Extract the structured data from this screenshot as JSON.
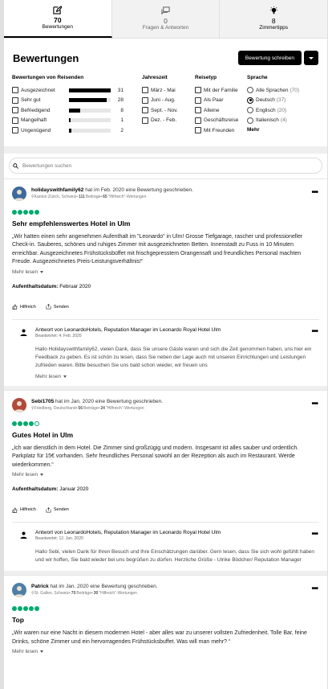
{
  "tabs": [
    {
      "count": "70",
      "label": "Bewertungen",
      "icon": "edit-icon"
    },
    {
      "count": "0",
      "label": "Fragen & Antworten",
      "icon": "chat-icon"
    },
    {
      "count": "8",
      "label": "Zimmertipps",
      "icon": "lightbulb-icon"
    }
  ],
  "header": {
    "title": "Bewertungen",
    "write_label": "Bewertung schreiben"
  },
  "filters": {
    "ratings_title": "Bewertungen von Reisenden",
    "ratings": [
      {
        "label": "Ausgezeichnet",
        "count": "31",
        "fraction": 1.0
      },
      {
        "label": "Sehr gut",
        "count": "28",
        "fraction": 0.9
      },
      {
        "label": "Befriedigend",
        "count": "8",
        "fraction": 0.26
      },
      {
        "label": "Mangelhaft",
        "count": "1",
        "fraction": 0.03
      },
      {
        "label": "Ungenügend",
        "count": "2",
        "fraction": 0.06
      }
    ],
    "season_title": "Jahreszeit",
    "seasons": [
      "März - Mai",
      "Juni - Aug.",
      "Sept. - Nov.",
      "Dez. - Feb."
    ],
    "type_title": "Reisetyp",
    "types": [
      "Mit der Familie",
      "Als Paar",
      "Alleine",
      "Geschäftsreise",
      "Mit Freunden"
    ],
    "lang_title": "Sprache",
    "langs": [
      {
        "label": "Alle Sprachen",
        "count": "(70)",
        "selected": false
      },
      {
        "label": "Deutsch",
        "count": "(37)",
        "selected": true
      },
      {
        "label": "Englisch",
        "count": "(20)",
        "selected": false
      },
      {
        "label": "Italienisch",
        "count": "(4)",
        "selected": false
      }
    ],
    "more_label": "Mehr"
  },
  "search": {
    "placeholder": "Bewertungen suchen"
  },
  "reviews": [
    {
      "user": "holidayswithfamily62",
      "action": "hat im Feb. 2020 eine Bewertung geschrieben.",
      "location": "Kanton Zürich, Schweiz",
      "contrib_count": "111",
      "contrib_label": "Beiträge",
      "helpful_count": "65",
      "helpful_label": "\"Hilfreich\"-Wertungen",
      "rating": 5,
      "title": "Sehr empfehlenswertes Hotel in Ulm",
      "text": "„Wir hatten einen sehr angenehmen Aufenthalt im \"Leonardo\" in Ulm! Grosse Tiefgarage, rascher und professioneller Check-in. Sauberes, schönes und ruhiges Zimmer mit ausgezeichneten Betten. Innenstadt zu Fuss in 10 Minuten erreichbar. Ausgezeichnetes Frühstücksbüffet mit frischgepresstem Orangensaft und freundliches Personal machten Freude. Ausgezeichnetes Preis-Leistungsverhältnis!“",
      "more": "Mehr lesen",
      "stay_label": "Aufenthaltsdatum:",
      "stay_value": "Februar 2020",
      "helpful_btn": "Hilfreich",
      "share_btn": "Senden",
      "response": {
        "name": "Antwort von LeonardoHotels, Reputation Manager im Leonardo Royal Hotel Ulm",
        "date": "Beantwortet: 4. Feb. 2020",
        "text": "Hallo Holidayswithfamily62, vielen Dank, dass Sie unsere Gäste waren und sich die Zeit genommen haben, uns hier ein Feedback zu geben. Es ist schön zu lesen, dass Sie neben der Lage auch mit unseren Einrichtungen und Leistungen zufrieden waren. Bitte besuchen Sie uns bald schon wieder, wir freuen uns",
        "more": "Mehr lesen"
      }
    },
    {
      "user": "Sebi1705",
      "action": "hat im Jan. 2020 eine Bewertung geschrieben.",
      "location": "Friedberg, Deutschland",
      "contrib_count": "56",
      "contrib_label": "Beiträge",
      "helpful_count": "24",
      "helpful_label": "\"Hilfreich\"-Wertungen",
      "rating": 4,
      "title": "Gutes Hotel in Ulm",
      "text": "„Ich war dienstlich in dem Hotel. Die Zimmer sind großzügig und modern. Insgesamt ist alles sauber und ordentlich. Parkplatz für 15€ vorhanden. Sehr freundliches Personal sowohl an der Rezeption als auch im Restaurant. Werde wiederkommen.“",
      "more": "Mehr lesen",
      "stay_label": "Aufenthaltsdatum:",
      "stay_value": "Januar 2020",
      "helpful_btn": "Hilfreich",
      "share_btn": "Senden",
      "response": {
        "name": "Antwort von LeonardoHotels, Reputation Manager im Leonardo Royal Hotel Ulm",
        "date": "Beantwortet: 12. Jan. 2020",
        "text": "Hallo Sebi, vielen Dank für Ihren Besuch und Ihre Einschätzungen darüber. Gern lesen, dass Sie sich wohl gefühlt haben und wir hoffen, Sie bald wieder bei uns begrüßen zu dürfen. Herzliche Grüße - Ulrike Bödcher/ Reputation Manager"
      }
    },
    {
      "user": "Patrick",
      "action": "hat im Jan. 2020 eine Bewertung geschrieben.",
      "location": "St. Gallen, Schweiz",
      "contrib_count": "70",
      "contrib_label": "Beiträge",
      "helpful_count": "30",
      "helpful_label": "\"Hilfreich\"-Wertungen",
      "rating": 5,
      "title": "Top",
      "text": "„Wir waren nur eine Nacht in diesem modernen Hotel - aber alles war zu unserer vollsten Zufriedenheit. Tolle Bar, feine Drinks, schöne Zimmer und ein hervorragendes Frühstücksbuffet. Was will man mehr? “",
      "more": "Mehr lesen"
    }
  ],
  "colors": {
    "bubble": "#00aa6c",
    "button": "#000000"
  }
}
